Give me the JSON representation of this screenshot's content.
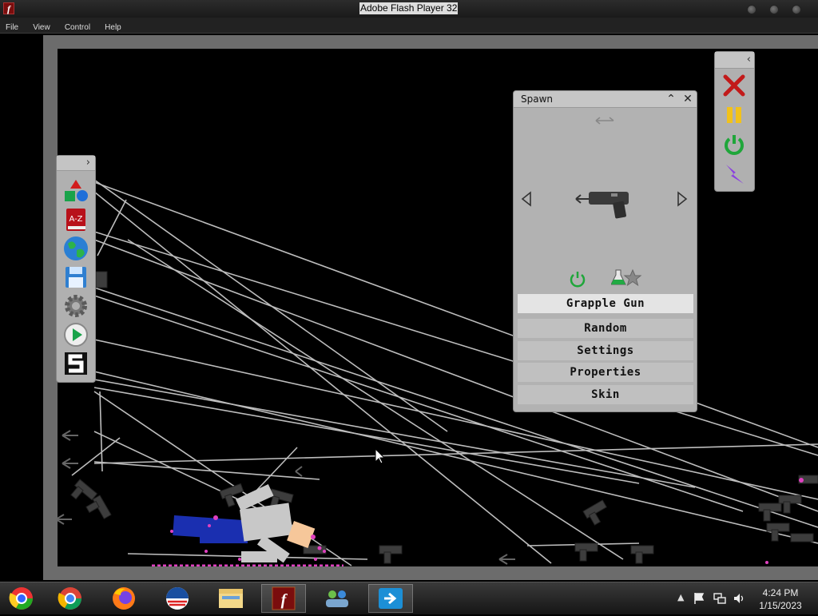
{
  "window": {
    "title": "Adobe Flash Player 32",
    "app_icon_glyph": "f"
  },
  "menu": [
    {
      "label": "File"
    },
    {
      "label": "View"
    },
    {
      "label": "Control"
    },
    {
      "label": "Help"
    }
  ],
  "left_toolbar": {
    "collapse_glyph": "›",
    "tools": [
      {
        "name": "shapes-tool",
        "icon": "shapes-icon"
      },
      {
        "name": "dictionary-tool",
        "icon": "dictionary-icon",
        "text": "A-Z"
      },
      {
        "name": "world-tool",
        "icon": "globe-icon"
      },
      {
        "name": "save-tool",
        "icon": "floppy-disk-icon"
      },
      {
        "name": "settings-tool",
        "icon": "gear-icon"
      },
      {
        "name": "play-tool",
        "icon": "play-icon"
      },
      {
        "name": "s-tool",
        "icon": "s-logo-icon"
      }
    ]
  },
  "right_toolbar": {
    "collapse_glyph": "‹",
    "controls": [
      {
        "name": "clear",
        "icon": "red-x-icon"
      },
      {
        "name": "pause",
        "icon": "pause-icon"
      },
      {
        "name": "reset",
        "icon": "power-icon"
      },
      {
        "name": "slowmo",
        "icon": "lightning-icon"
      }
    ]
  },
  "spawn_panel": {
    "title": "Spawn",
    "minimize_glyph": "⌃",
    "close_glyph": "✕",
    "selected_item": "Grapple Gun",
    "options": [
      "Random",
      "Settings",
      "Properties",
      "Skin"
    ]
  },
  "taskbar": {
    "apps": [
      {
        "name": "chrome-legacy",
        "icon": "chrome-icon"
      },
      {
        "name": "chrome",
        "icon": "chrome-icon"
      },
      {
        "name": "firefox",
        "icon": "firefox-icon"
      },
      {
        "name": "obama-app",
        "icon": "logo-icon"
      },
      {
        "name": "file-explorer",
        "icon": "folder-icon"
      },
      {
        "name": "flash-player",
        "icon": "flash-icon"
      },
      {
        "name": "messenger",
        "icon": "people-icon"
      },
      {
        "name": "remote-app",
        "icon": "remote-icon"
      }
    ],
    "time": "4:24 PM",
    "date": "1/15/2023"
  },
  "colors": {
    "panel_bg": "#b2b2b2",
    "selected_row": "#e4e4e4",
    "rope": "#bdbdbd",
    "ragdoll_blue": "#1a2fb0",
    "ragdoll_skin": "#f6c79a",
    "blood": "#e040c0"
  }
}
